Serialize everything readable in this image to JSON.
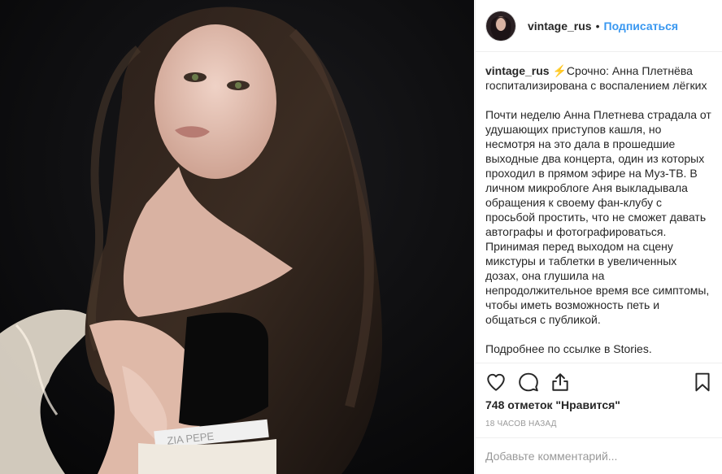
{
  "post": {
    "username": "vintage_rus",
    "dot": "•",
    "follow_label": "Подписаться"
  },
  "caption": {
    "username": "vintage_rus",
    "headline": "⚡Срочно: Анна Плетнёва госпитализирована с воспалением лёгких",
    "body": "Почти неделю Анна Плетнева страдала от удушающих приступов кашля, но несмотря на это дала в прошедшие выходные два концерта, один из которых проходил в прямом эфире на Муз-ТВ. В личном микроблоге Аня выкладывала обращения к своему фан-клубу с просьбой простить, что не сможет давать автографы и фотографироваться. Принимая перед выходом на сцену микстуры и таблетки в увеличенных дозах, она глушила на непродолжительное время все симптомы, чтобы иметь возможность петь и общаться с публикой.",
    "footer": "Подробнее по ссылке в Stories."
  },
  "photo": {
    "top_print": "ZIA PEPE"
  },
  "stats": {
    "likes": "748 отметок \"Нравится\"",
    "time": "18 часов назад"
  },
  "comment": {
    "placeholder": "Добавьте комментарий..."
  },
  "icons": {
    "like": "heart-icon",
    "comment": "comment-bubble-icon",
    "share": "share-icon",
    "save": "bookmark-icon"
  },
  "colors": {
    "link_blue": "#3897f0",
    "text": "#262626",
    "muted": "#999999",
    "border": "#efefef",
    "photo_bg": "#0d0d0f"
  }
}
